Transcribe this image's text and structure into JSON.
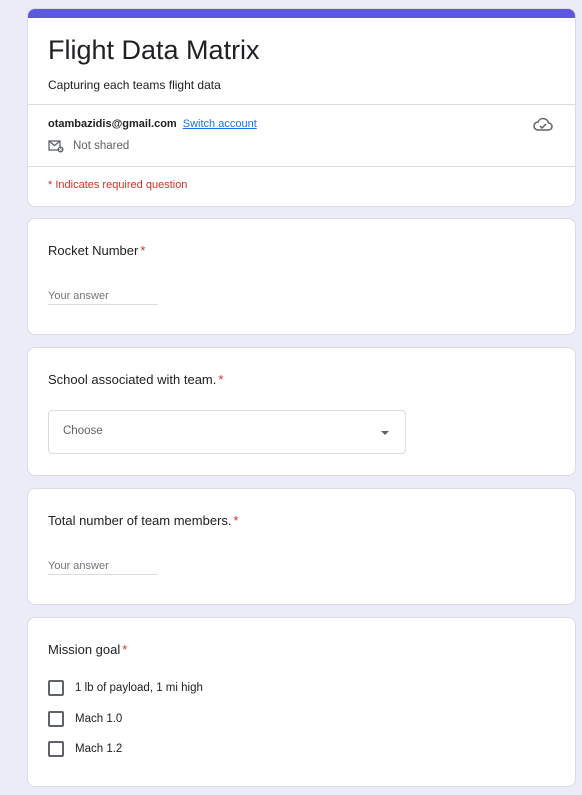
{
  "header": {
    "title": "Flight Data Matrix",
    "description": "Capturing each teams flight data",
    "account_email": "otambazidis@gmail.com",
    "switch_account": "Switch account",
    "shared_status": "Not shared",
    "required_note": "* Indicates required question"
  },
  "questions": {
    "rocket_number": {
      "label": "Rocket Number",
      "required": "*",
      "placeholder": "Your answer"
    },
    "school": {
      "label": "School associated with team.",
      "required": "*",
      "dropdown_value": "Choose"
    },
    "team_members": {
      "label": "Total number of team members.",
      "required": "*",
      "placeholder": "Your answer"
    },
    "mission_goal": {
      "label": "Mission goal",
      "required": "*",
      "options": [
        "1 lb of payload, 1 mi high",
        "Mach 1.0",
        "Mach 1.2"
      ]
    }
  },
  "colors": {
    "accent": "#5E57DF",
    "background": "#ECEBF8",
    "required": "#d93025",
    "link": "#1a73e8"
  },
  "icons": {
    "cloud": "cloud-check-icon",
    "shared": "not-shared-mail-icon",
    "dropdown": "arrow-drop-down-icon"
  }
}
